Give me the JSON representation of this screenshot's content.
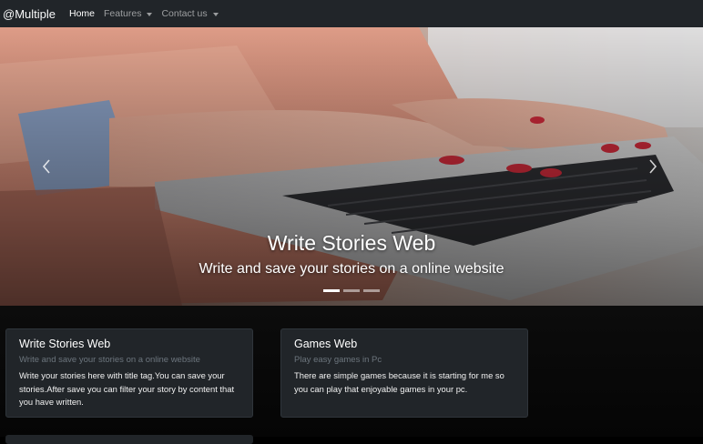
{
  "navbar": {
    "brand": "@Multiple",
    "links": [
      {
        "label": "Home",
        "active": true
      },
      {
        "label": "Features",
        "dropdown": true
      },
      {
        "label": "Contact us",
        "dropdown": true
      }
    ]
  },
  "carousel": {
    "title": "Write Stories Web",
    "subtitle": "Write and save your stories on a online website",
    "indicator_count": 3,
    "active_indicator": 0,
    "prev_icon": "chevron-left-icon",
    "next_icon": "chevron-right-icon"
  },
  "cards": [
    {
      "title": "Write Stories Web",
      "subtitle": "Write and save your stories on a online website",
      "text": "Write your stories here with title tag.You can save your stories.After save you can filter your story by content that you have written."
    },
    {
      "title": "Games Web",
      "subtitle": "Play easy games in Pc",
      "text": "There are simple games because it is starting for me so you can play that enjoyable games in your pc."
    }
  ],
  "colors": {
    "navbar_bg": "#212529",
    "card_bg": "#212529",
    "page_bg": "#000000",
    "muted_text": "#6c757d"
  }
}
